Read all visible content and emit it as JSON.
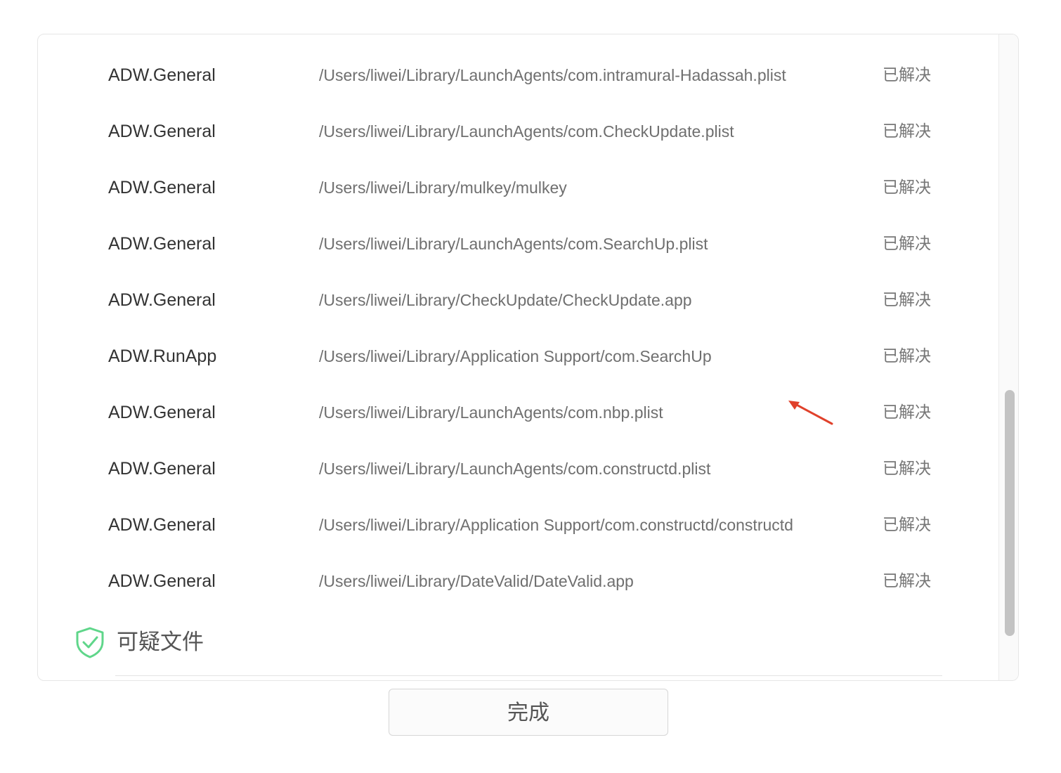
{
  "results": {
    "rows": [
      {
        "type": "ADW.General",
        "path": "/Users/liwei/Library/LaunchAgents/com.intramural-Hadassah.plist",
        "status": "已解决"
      },
      {
        "type": "ADW.General",
        "path": "/Users/liwei/Library/LaunchAgents/com.CheckUpdate.plist",
        "status": "已解决"
      },
      {
        "type": "ADW.General",
        "path": "/Users/liwei/Library/mulkey/mulkey",
        "status": "已解决"
      },
      {
        "type": "ADW.General",
        "path": "/Users/liwei/Library/LaunchAgents/com.SearchUp.plist",
        "status": "已解决"
      },
      {
        "type": "ADW.General",
        "path": "/Users/liwei/Library/CheckUpdate/CheckUpdate.app",
        "status": "已解决"
      },
      {
        "type": "ADW.RunApp",
        "path": "/Users/liwei/Library/Application Support/com.SearchUp",
        "status": "已解决"
      },
      {
        "type": "ADW.General",
        "path": "/Users/liwei/Library/LaunchAgents/com.nbp.plist",
        "status": "已解决"
      },
      {
        "type": "ADW.General",
        "path": "/Users/liwei/Library/LaunchAgents/com.constructd.plist",
        "status": "已解决"
      },
      {
        "type": "ADW.General",
        "path": "/Users/liwei/Library/Application Support/com.constructd/constructd",
        "status": "已解决"
      },
      {
        "type": "ADW.General",
        "path": "/Users/liwei/Library/DateValid/DateValid.app",
        "status": "已解决"
      }
    ]
  },
  "section": {
    "title": "可疑文件",
    "icon": "shield-check-icon"
  },
  "footer": {
    "done_label": "完成"
  },
  "colors": {
    "shield": "#5fd68a",
    "annotation_arrow": "#e0412b",
    "scrollbar_thumb": "#c3c3c3"
  }
}
